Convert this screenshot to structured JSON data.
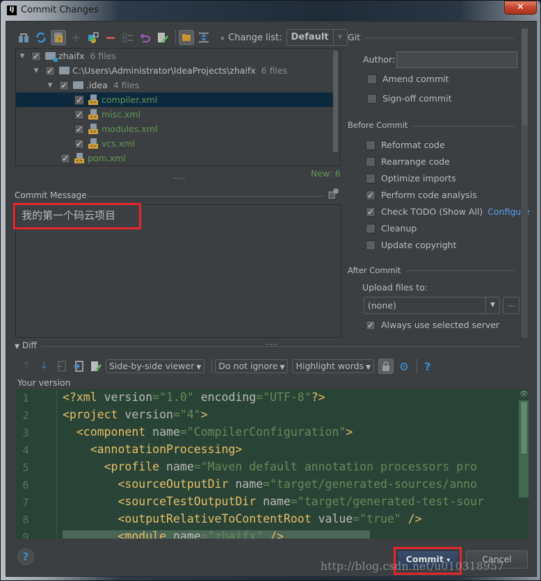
{
  "window": {
    "title": "Commit Changes",
    "logo": "IJ",
    "close_label": "✕"
  },
  "toolbar": {
    "icons": [
      "show-diff-icon",
      "refresh-icon",
      "group-by-icon",
      "add-icon",
      "move-to-changelist-icon",
      "delete-icon",
      "select-icon",
      "revert-icon",
      "edit-source-icon",
      "group-by-directory-icon",
      "expand-all-icon"
    ],
    "overflow": "»",
    "changelist_label": "Change list:",
    "changelist_value": "Default"
  },
  "tree": {
    "rows": [
      {
        "name": "zhaifx",
        "count": "6 files",
        "type": "module",
        "checked": true
      },
      {
        "name": "C:\\Users\\Administrator\\IdeaProjects\\zhaifx",
        "count": "6 files",
        "type": "folder",
        "checked": true
      },
      {
        "name": ".idea",
        "count": "4 files",
        "type": "folder",
        "checked": true
      },
      {
        "name": "compiler.xml",
        "type": "xml",
        "checked": true,
        "selected": true
      },
      {
        "name": "misc.xml",
        "type": "xml",
        "checked": true
      },
      {
        "name": "modules.xml",
        "type": "xml",
        "checked": true
      },
      {
        "name": "vcs.xml",
        "type": "xml",
        "checked": true
      },
      {
        "name": "pom.xml",
        "type": "xml",
        "checked": true
      }
    ],
    "status": "New: 6"
  },
  "commit_message": {
    "label": "Commit Message",
    "value": "我的第一个码云项目"
  },
  "git": {
    "section_label": "Git",
    "author_label": "Author:",
    "author_value": "",
    "amend_label": "Amend commit",
    "amend_checked": false,
    "signoff_label": "Sign-off commit",
    "signoff_checked": false
  },
  "before_commit": {
    "label": "Before Commit",
    "options": [
      {
        "label": "Reformat code",
        "checked": false
      },
      {
        "label": "Rearrange code",
        "checked": false
      },
      {
        "label": "Optimize imports",
        "checked": false
      },
      {
        "label": "Perform code analysis",
        "checked": true
      },
      {
        "label": "Check TODO (Show All)",
        "checked": true,
        "link": "Configure"
      },
      {
        "label": "Cleanup",
        "checked": false
      },
      {
        "label": "Update copyright",
        "checked": false
      }
    ]
  },
  "after_commit": {
    "label": "After Commit",
    "upload_label": "Upload files to:",
    "upload_value": "(none)",
    "more_label": "...",
    "always_label": "Always use selected server",
    "always_checked": true
  },
  "diff": {
    "label": "Diff",
    "viewer": "Side-by-side viewer",
    "ignore": "Do not ignore",
    "highlight": "Highlight words",
    "help": "?",
    "your_version_label": "Your version",
    "lines": [
      {
        "n": "1",
        "indent": "",
        "parts": [
          [
            "t",
            "<?xml "
          ],
          [
            "a2",
            "version"
          ],
          [
            "s",
            "=\"1.0\" "
          ],
          [
            "a2",
            "encoding"
          ],
          [
            "s",
            "=\"UTF-8\""
          ],
          [
            "t",
            "?>"
          ]
        ]
      },
      {
        "n": "2",
        "indent": "",
        "parts": [
          [
            "t",
            "<project "
          ],
          [
            "a2",
            "version"
          ],
          [
            "s",
            "=\"4\""
          ],
          [
            "t",
            ">"
          ]
        ]
      },
      {
        "n": "3",
        "indent": "  ",
        "parts": [
          [
            "t",
            "<component "
          ],
          [
            "a2",
            "name"
          ],
          [
            "s",
            "=\"CompilerConfiguration\""
          ],
          [
            "t",
            ">"
          ]
        ]
      },
      {
        "n": "4",
        "indent": "    ",
        "parts": [
          [
            "t",
            "<annotationProcessing>"
          ]
        ]
      },
      {
        "n": "5",
        "indent": "      ",
        "parts": [
          [
            "t",
            "<profile "
          ],
          [
            "a2",
            "name"
          ],
          [
            "s",
            "=\"Maven default annotation processors pro"
          ]
        ]
      },
      {
        "n": "6",
        "indent": "        ",
        "parts": [
          [
            "t",
            "<sourceOutputDir "
          ],
          [
            "a2",
            "name"
          ],
          [
            "s",
            "=\"target/generated-sources/anno"
          ]
        ]
      },
      {
        "n": "7",
        "indent": "        ",
        "parts": [
          [
            "t",
            "<sourceTestOutputDir "
          ],
          [
            "a2",
            "name"
          ],
          [
            "s",
            "=\"target/generated-test-sour"
          ]
        ]
      },
      {
        "n": "8",
        "indent": "        ",
        "parts": [
          [
            "t",
            "<outputRelativeToContentRoot "
          ],
          [
            "a2",
            "value"
          ],
          [
            "s",
            "=\"true\" "
          ],
          [
            "t",
            "/>"
          ]
        ]
      },
      {
        "n": "9",
        "indent": "        ",
        "parts": [
          [
            "t",
            "<module "
          ],
          [
            "a2",
            "name"
          ],
          [
            "s",
            "=\"zhaifx\" "
          ],
          [
            "t",
            "/>"
          ]
        ]
      }
    ]
  },
  "buttons": {
    "help": "?",
    "commit": "Commit",
    "commit_arrow": "▾",
    "cancel": "Cancel"
  },
  "watermark": "http://blog.csdn.net/u010318957",
  "colors": {
    "new_file": "#629755",
    "link": "#589df6",
    "highlight_box": "#e8262a",
    "diff_bg": "#294436"
  }
}
